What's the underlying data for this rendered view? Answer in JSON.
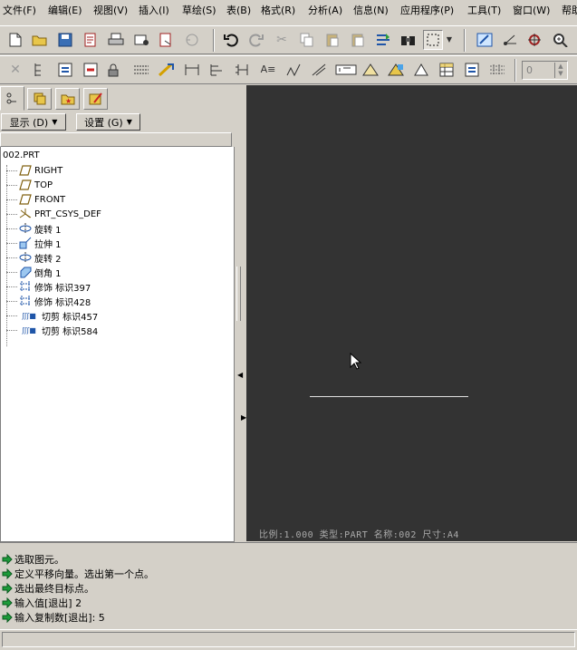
{
  "menu": [
    "文件(F)",
    "编辑(E)",
    "视图(V)",
    "插入(I)",
    "草绘(S)",
    "表(B)",
    "格式(R)",
    "分析(A)",
    "信息(N)",
    "应用程序(P)",
    "工具(T)",
    "窗口(W)",
    "帮助"
  ],
  "spinbox": {
    "value": "0"
  },
  "tabs": [
    "model-tree",
    "layers",
    "favorites",
    "connections"
  ],
  "tree_panel": {
    "show_label": "显示 (D)",
    "settings_label": "设置 (G)",
    "root": "002.PRT",
    "items": [
      {
        "label": "RIGHT",
        "icon": "datum-plane-icon"
      },
      {
        "label": "TOP",
        "icon": "datum-plane-icon"
      },
      {
        "label": "FRONT",
        "icon": "datum-plane-icon"
      },
      {
        "label": "PRT_CSYS_DEF",
        "icon": "coordinate-system-icon"
      },
      {
        "label": "旋转 1",
        "icon": "revolve-icon"
      },
      {
        "label": "拉伸 1",
        "icon": "extrude-icon"
      },
      {
        "label": "旋转 2",
        "icon": "revolve-icon"
      },
      {
        "label": "倒角 1",
        "icon": "chamfer-icon"
      },
      {
        "label": "修饰 标识397",
        "icon": "cosmetic-icon"
      },
      {
        "label": "修饰 标识428",
        "icon": "cosmetic-icon"
      },
      {
        "label": "切剪 标识457",
        "icon": "cut-icon"
      },
      {
        "label": "切剪 标识584",
        "icon": "cut-icon"
      }
    ]
  },
  "viewport": {
    "background": "#333333",
    "status_line": "比例:1.000   类型:PART   名称:002   尺寸:A4"
  },
  "messages": [
    "选取图元。",
    "定义平移向量。选出第一个点。",
    "选出最终目标点。",
    "输入值[退出]  2",
    "输入复制数[退出]:  5"
  ],
  "colors": {
    "message_arrow": "#1c9b3a",
    "panel": "#d4d0c8"
  }
}
